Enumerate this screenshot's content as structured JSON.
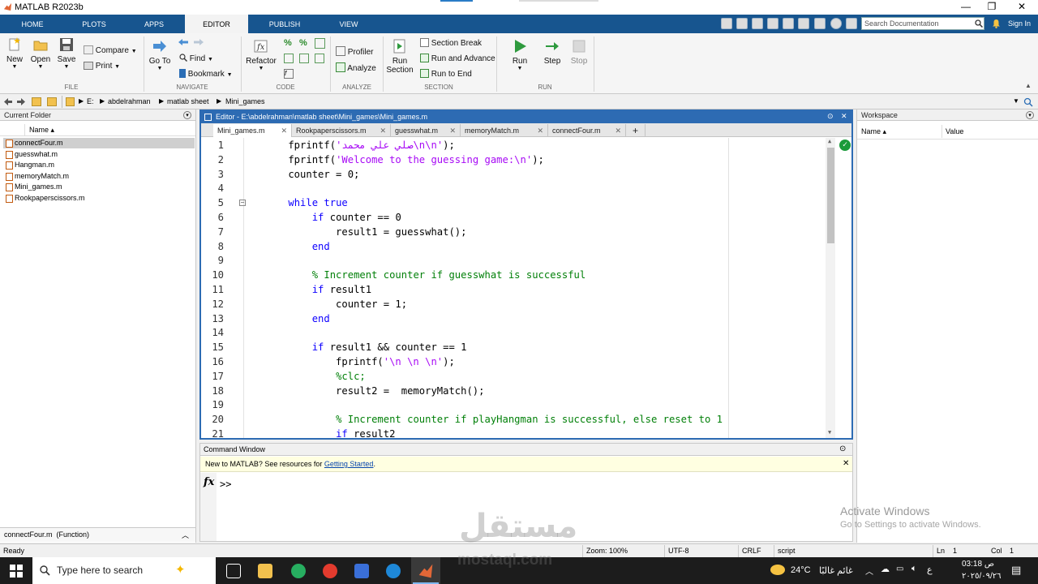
{
  "window": {
    "title": "MATLAB R2023b",
    "controls": [
      "—",
      "❐",
      "✕"
    ]
  },
  "tabs": [
    "HOME",
    "PLOTS",
    "APPS",
    "EDITOR",
    "PUBLISH",
    "VIEW"
  ],
  "search_doc": {
    "placeholder": "Search Documentation"
  },
  "sign_in": "Sign In",
  "ribbon": {
    "file": {
      "new": "New",
      "open": "Open",
      "save": "Save",
      "compare": "Compare",
      "print": "Print",
      "section": "FILE"
    },
    "navigate": {
      "goto_line1": "Go To",
      "find": "Find",
      "bookmark": "Bookmark",
      "section": "NAVIGATE"
    },
    "code": {
      "refactor": "Refactor",
      "section": "CODE"
    },
    "analyze": {
      "profiler": "Profiler",
      "analyze": "Analyze",
      "section": "ANALYZE"
    },
    "section_grp": {
      "run_section_1": "Run",
      "run_section_2": "Section",
      "section_break": "Section Break",
      "run_and_advance": "Run and Advance",
      "run_to_end": "Run to End",
      "section": "SECTION"
    },
    "run": {
      "run": "Run",
      "step": "Step",
      "stop": "Stop",
      "section": "RUN"
    }
  },
  "address": {
    "drive": "E:",
    "parts": [
      "abdelrahman",
      "matlab sheet",
      "Mini_games"
    ]
  },
  "current_folder": {
    "title": "Current Folder",
    "column": "Name ▴",
    "files": [
      "connectFour.m",
      "guesswhat.m",
      "Hangman.m",
      "memoryMatch.m",
      "Mini_games.m",
      "Rookpaperscissors.m"
    ],
    "selected_index": 0,
    "details": "connectFour.m  (Function)"
  },
  "editor": {
    "header": "Editor - E:\\abdelrahman\\matlab sheet\\Mini_games\\Mini_games.m",
    "tabs": [
      "Mini_games.m",
      "Rookpaperscissors.m",
      "guesswhat.m",
      "memoryMatch.m",
      "connectFour.m"
    ],
    "add_tab": "+",
    "lines": [
      "    fprintf('صلي علي محمد\\n\\n');",
      "    fprintf('Welcome to the guessing game:\\n');",
      "    counter = 0;",
      "",
      "    while true",
      "        if counter == 0",
      "            result1 = guesswhat();",
      "        end",
      "",
      "        % Increment counter if guesswhat is successful",
      "        if result1",
      "            counter = 1;",
      "        end",
      "",
      "        if result1 && counter == 1",
      "            fprintf('\\n \\n \\n');",
      "            %clc;",
      "            result2 =  memoryMatch();",
      "",
      "            % Increment counter if playHangman is successful, else reset to 1",
      "            if result2"
    ]
  },
  "command_window": {
    "title": "Command Window",
    "notice_prefix": "New to MATLAB? See resources for ",
    "notice_link": "Getting Started",
    "notice_suffix": ".",
    "prompt": ">>",
    "fx": "fx"
  },
  "workspace": {
    "title": "Workspace",
    "col_name": "Name ▴",
    "col_value": "Value"
  },
  "status": {
    "ready": "Ready",
    "zoom": "Zoom: 100%",
    "encoding": "UTF-8",
    "eol": "CRLF",
    "type": "script",
    "ln_label": "Ln",
    "ln": "1",
    "col_label": "Col",
    "col": "1"
  },
  "activate": {
    "line1": "Activate Windows",
    "line2": "Go to Settings to activate Windows."
  },
  "watermark": {
    "arabic": "مستقل",
    "latin": "mostaql.com"
  },
  "taskbar": {
    "search_placeholder": "Type here to search",
    "weather": "24°C",
    "weather_desc": "غائم غالبًا",
    "lang": "ع",
    "time": "03:18 ص",
    "date": "٢٠٢٥/٠٩/٢٦"
  }
}
